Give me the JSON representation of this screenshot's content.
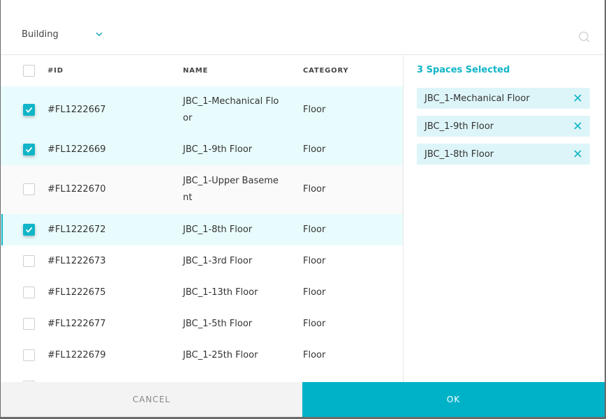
{
  "filter": {
    "selected": "Building"
  },
  "table": {
    "headers": {
      "id": "#ID",
      "name": "NAME",
      "category": "CATEGORY"
    },
    "rows": [
      {
        "id": "#FL1222667",
        "name": "JBC_1-Mechanical Floor",
        "category": "Floor",
        "checked": true
      },
      {
        "id": "#FL1222669",
        "name": "JBC_1-9th Floor",
        "category": "Floor",
        "checked": true
      },
      {
        "id": "#FL1222670",
        "name": "JBC_1-Upper Basement",
        "category": "Floor",
        "checked": false
      },
      {
        "id": "#FL1222672",
        "name": "JBC_1-8th Floor",
        "category": "Floor",
        "checked": true
      },
      {
        "id": "#FL1222673",
        "name": "JBC_1-3rd Floor",
        "category": "Floor",
        "checked": false
      },
      {
        "id": "#FL1222675",
        "name": "JBC_1-13th Floor",
        "category": "Floor",
        "checked": false
      },
      {
        "id": "#FL1222677",
        "name": "JBC_1-5th Floor",
        "category": "Floor",
        "checked": false
      },
      {
        "id": "#FL1222679",
        "name": "JBC_1-25th Floor",
        "category": "Floor",
        "checked": false
      }
    ]
  },
  "selection": {
    "count_label": "3 Spaces Selected",
    "chips": [
      {
        "label": "JBC_1-Mechanical Floor"
      },
      {
        "label": "JBC_1-9th Floor"
      },
      {
        "label": "JBC_1-8th Floor"
      }
    ]
  },
  "footer": {
    "cancel_label": "CANCEL",
    "ok_label": "OK"
  },
  "colors": {
    "accent": "#00b2c8",
    "selected_row": "#e9fcfd",
    "chip_bg": "#ddf5f8"
  },
  "icons": {
    "filter_toggle": "chevron-down-icon",
    "search": "search-icon",
    "remove": "close-icon",
    "checkbox": "checkmark-icon"
  }
}
